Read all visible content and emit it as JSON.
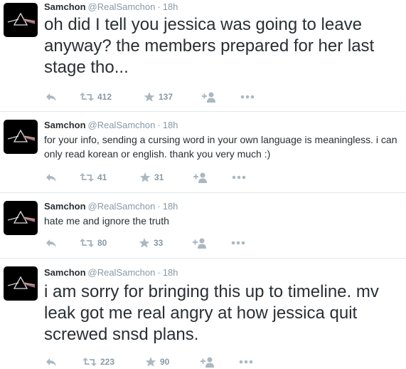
{
  "tweets": [
    {
      "name": "Samchon",
      "handle": "@RealSamchon",
      "separator": "·",
      "time": "18h",
      "text": "oh did I tell you jessica was going to leave anyway? the members prepared for her last stage tho...",
      "retweets": "412",
      "favorites": "137"
    },
    {
      "name": "Samchon",
      "handle": "@RealSamchon",
      "separator": "·",
      "time": "18h",
      "text": "for your info, sending a cursing word in your own language is meaningless. i can only read korean or english. thank you very much :)",
      "retweets": "41",
      "favorites": "31"
    },
    {
      "name": "Samchon",
      "handle": "@RealSamchon",
      "separator": "·",
      "time": "18h",
      "text": "hate me and ignore the truth",
      "retweets": "80",
      "favorites": "33"
    },
    {
      "name": "Samchon",
      "handle": "@RealSamchon",
      "separator": "·",
      "time": "18h",
      "text": "i am sorry for bringing this up to timeline. mv leak got me real angry at how jessica quit screwed snsd plans.",
      "retweets": "223",
      "favorites": "90"
    }
  ],
  "icons": {
    "reply": "reply-icon",
    "retweet": "retweet-icon",
    "favorite": "star-icon",
    "follow": "follow-icon",
    "more": "more-icon",
    "avatar": "prism-icon"
  },
  "colors": {
    "icon_gray": "#aab8c2",
    "text_gray": "#8899a6",
    "text_dark": "#292f33"
  }
}
